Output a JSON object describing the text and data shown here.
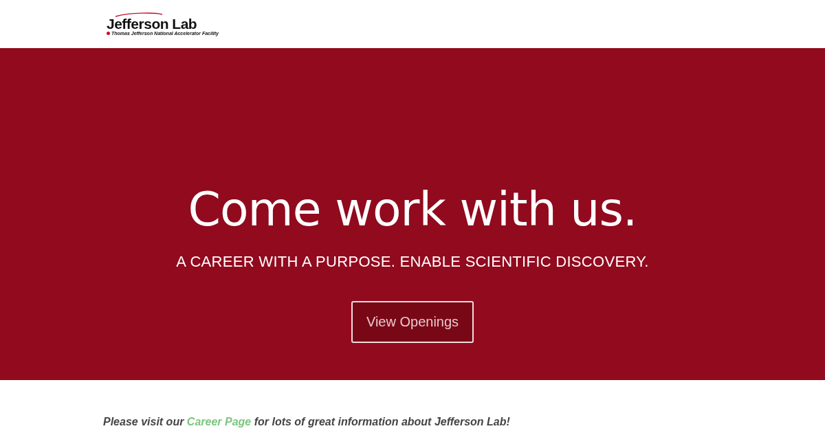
{
  "header": {
    "logo": {
      "name": "Jefferson Lab",
      "tagline": "Thomas Jefferson National Accelerator Facility"
    }
  },
  "hero": {
    "title": "Come work with us.",
    "subtitle": "A CAREER WITH A PURPOSE. ENABLE SCIENTIFIC DISCOVERY.",
    "button": "View Openings"
  },
  "intro": {
    "before": "Please visit our ",
    "link": "Career Page",
    "after": " for lots of great information about Jefferson Lab!"
  }
}
